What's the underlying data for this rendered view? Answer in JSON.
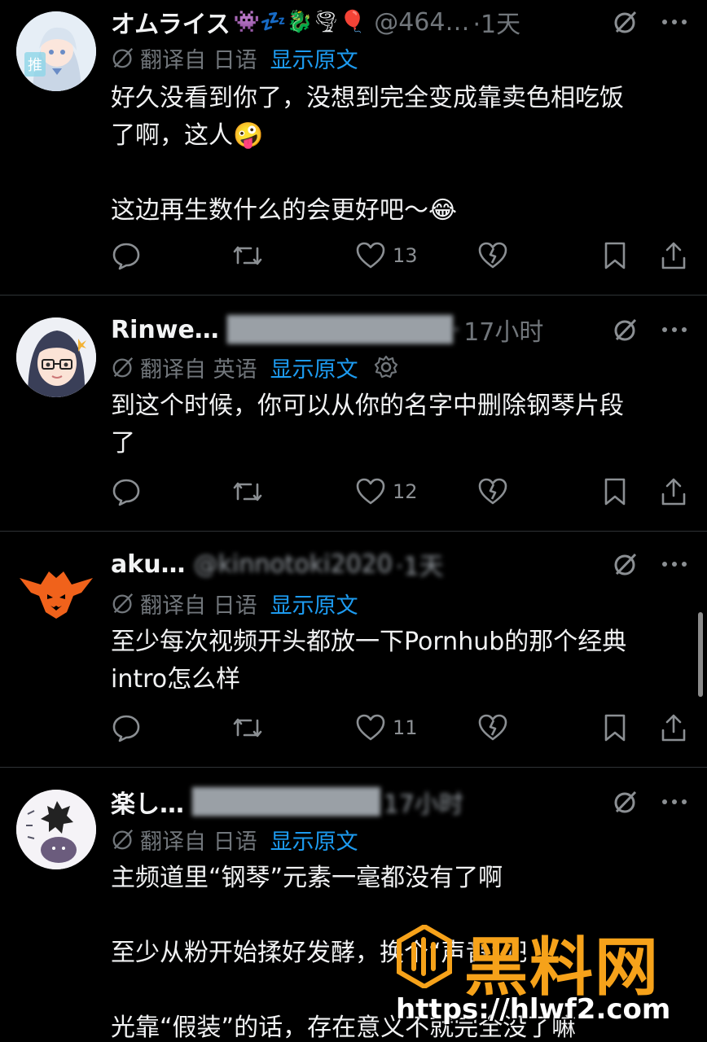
{
  "replies": [
    {
      "name": "オムライス",
      "emojis": "👾💤🐉🌪🎈",
      "handle": "@464…",
      "time": "·1天",
      "translate_label": "翻译自 日语",
      "show_original": "显示原文",
      "lines": [
        "好久没看到你了，没想到完全变成靠卖色相吃饭",
        "了啊，这人🤪",
        "",
        "这边再生数什么的会更好吧～😂"
      ],
      "likes": "13"
    },
    {
      "name": "Rinwe…",
      "time": "17小时",
      "translate_label": "翻译自 英语",
      "show_original": "显示原文",
      "lines": [
        "到这个时候，你可以从你的名字中删除钢琴片段",
        "了"
      ],
      "likes": "12"
    },
    {
      "name": "aku…",
      "handle": "@kinnotoki2020",
      "time": "·1天",
      "translate_label": "翻译自 日语",
      "show_original": "显示原文",
      "lines": [
        "至少每次视频开头都放一下Pornhub的那个经典",
        "intro怎么样"
      ],
      "likes": "11"
    },
    {
      "name": "楽し…",
      "time": "17小时",
      "translate_label": "翻译自 日语",
      "show_original": "显示原文",
      "lines": [
        "主频道里“钢琴”元素一毫都没有了啊",
        "",
        "至少从粉开始揉好发酵，换个“声音”吧",
        "",
        "光靠“假装”的话，存在意义不就完全没了嘛"
      ]
    }
  ],
  "watermark": {
    "title": "黑料网",
    "url": "https://hlwf2.com"
  },
  "colors": {
    "background": "#000000",
    "link": "#1d9bf0",
    "muted": "#71767b",
    "watermark_orange": "#f6a21a"
  }
}
